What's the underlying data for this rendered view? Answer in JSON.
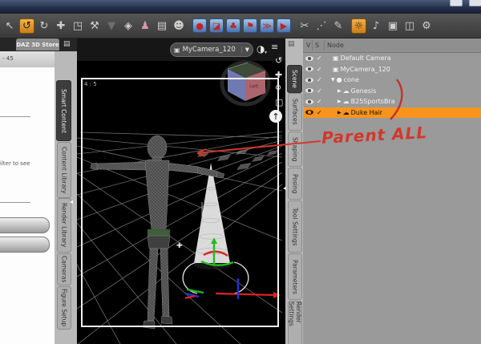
{
  "titlebar": {
    "note": "window controls partially visible"
  },
  "toolbar": {
    "icons": [
      {
        "name": "pointer-tool-icon",
        "glyph": "↖"
      },
      {
        "name": "universal-tool-icon",
        "glyph": "↺",
        "variant": "active"
      },
      {
        "name": "rotate-tool-icon",
        "glyph": "↻"
      },
      {
        "name": "translate-tool-icon",
        "glyph": "✚"
      },
      {
        "name": "scale-tool-icon",
        "glyph": "◳"
      },
      {
        "name": "joint-editor-icon",
        "glyph": "⚒"
      },
      {
        "name": "dropdown-arrow-icon",
        "glyph": "▼"
      },
      {
        "name": "surface-selection-icon",
        "glyph": "◈"
      },
      {
        "name": "figure-icon",
        "glyph": "♟"
      },
      {
        "name": "grid-list-icon",
        "glyph": "▤"
      },
      {
        "name": "character-bust-icon",
        "glyph": "☻"
      },
      {
        "name": "red-ball-icon",
        "glyph": "●"
      },
      {
        "name": "red-wedge-icon",
        "glyph": "◪"
      },
      {
        "name": "red-tree-icon",
        "glyph": "♣"
      },
      {
        "name": "red-flag-icon",
        "glyph": "⚑"
      },
      {
        "name": "red-arrows-icon",
        "glyph": "≫"
      },
      {
        "name": "red-play-icon",
        "glyph": "▶"
      },
      {
        "name": "scissors-icon",
        "glyph": "✂"
      },
      {
        "name": "hatch-lines-icon",
        "glyph": "⋰"
      },
      {
        "name": "pencil-edit-icon",
        "glyph": "✎"
      },
      {
        "name": "lightbulb-icon",
        "glyph": "☼",
        "variant": "active"
      },
      {
        "name": "render-note-icon",
        "glyph": "♪"
      },
      {
        "name": "camera-icon",
        "glyph": "▣"
      },
      {
        "name": "render-image-icon",
        "glyph": "◫"
      },
      {
        "name": "gear-icon",
        "glyph": "⚙"
      }
    ]
  },
  "left_panel": {
    "store_tab": "DAZ 3D Store",
    "dock_glyph": "▤",
    "count_text": "- 45",
    "hint_text": "ilter to see",
    "tabs": [
      "Smart Content",
      "Content Library",
      "Render Library",
      "Cameras",
      "Figure Setup"
    ],
    "selected_tab": "Smart Content",
    "handle_glyph": "◂"
  },
  "viewport": {
    "camera_selector": "MyCamera_120",
    "camera_glyph": "▣",
    "dropdown_glyph": "▼",
    "drawstyle_glyph": "◑",
    "drawstyle_dd_glyph": "▾",
    "menu_glyph": "≡",
    "aspect_label": "4 : 5",
    "cube_face_label": "Left",
    "move_cursor_glyph": "✚",
    "controls": [
      {
        "name": "orbit-icon",
        "glyph": "↺"
      },
      {
        "name": "pan-icon",
        "glyph": "✚"
      },
      {
        "name": "zoom-icon",
        "glyph": "⚲"
      },
      {
        "name": "frame-icon",
        "glyph": "▢"
      },
      {
        "name": "aspect-arrow-icon",
        "glyph": "↑"
      }
    ]
  },
  "right_tabs": {
    "tabs": [
      "Scene",
      "Surfaces",
      "Shaping",
      "Posing",
      "Tool Settings",
      "Parameters",
      "Render Settings"
    ],
    "selected_tab": "Scene",
    "panel_menu_glyph": "▤",
    "handle_glyph": "◂"
  },
  "scene_panel": {
    "columns": [
      "V",
      "S",
      "Node"
    ],
    "check_glyph": "✓",
    "highlight_color": "#F7941D",
    "rows": [
      {
        "label": "Default Camera",
        "expand_glyph": "",
        "type_glyph": "▣",
        "selected": false
      },
      {
        "label": "MyCamera_120",
        "expand_glyph": "",
        "type_glyph": "▣",
        "selected": false
      },
      {
        "label": "cone",
        "expand_glyph": "▼",
        "type_glyph": "●",
        "selected": false
      },
      {
        "label": "Genesis",
        "expand_glyph": "▶",
        "type_glyph": "☁",
        "selected": false
      },
      {
        "label": "B25SportsBra",
        "expand_glyph": "▶",
        "type_glyph": "☁",
        "selected": false
      },
      {
        "label": "Duke Hair",
        "expand_glyph": "▶",
        "type_glyph": "☁",
        "selected": true
      }
    ]
  },
  "annotation": {
    "text": "Parent ALL",
    "color": "#d2372a"
  }
}
